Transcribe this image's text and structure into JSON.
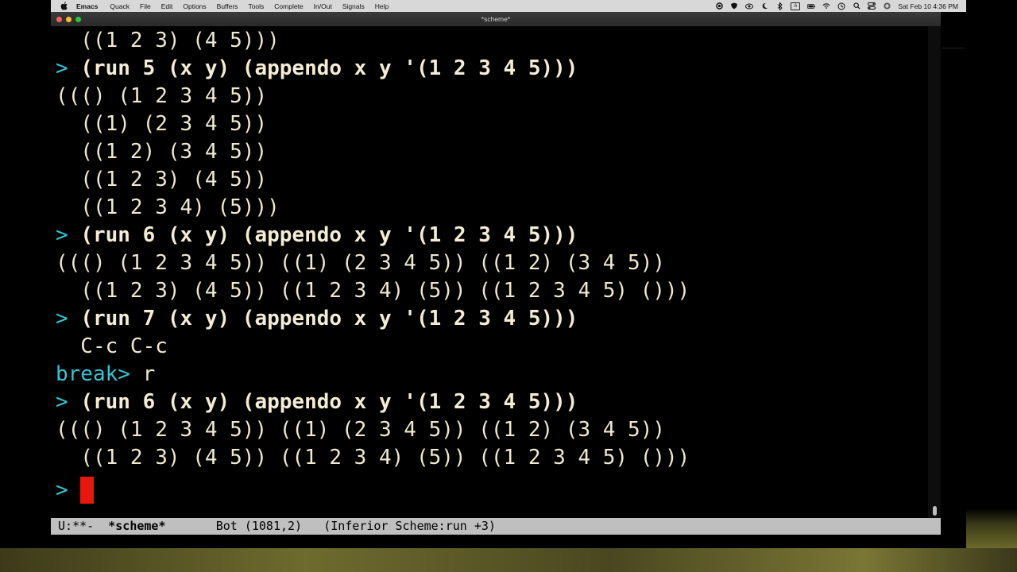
{
  "menubar": {
    "app_name": "Emacs",
    "items": [
      "Quack",
      "File",
      "Edit",
      "Options",
      "Buffers",
      "Tools",
      "Complete",
      "In/Out",
      "Signals",
      "Help"
    ],
    "clock": "Sat Feb 10  4:36 PM"
  },
  "window": {
    "title": "*scheme*"
  },
  "repl_lines": [
    {
      "type": "output",
      "text": "  ((1 2 3) (4 5)))"
    },
    {
      "type": "input",
      "prompt": "> ",
      "text": "(run 5 (x y) (appendo x y '(1 2 3 4 5)))"
    },
    {
      "type": "output",
      "text": "((() (1 2 3 4 5))"
    },
    {
      "type": "output",
      "text": "  ((1) (2 3 4 5))"
    },
    {
      "type": "output",
      "text": "  ((1 2) (3 4 5))"
    },
    {
      "type": "output",
      "text": "  ((1 2 3) (4 5))"
    },
    {
      "type": "output",
      "text": "  ((1 2 3 4) (5)))"
    },
    {
      "type": "input",
      "prompt": "> ",
      "text": "(run 6 (x y) (appendo x y '(1 2 3 4 5)))"
    },
    {
      "type": "output",
      "text": "((() (1 2 3 4 5)) ((1) (2 3 4 5)) ((1 2) (3 4 5))"
    },
    {
      "type": "output",
      "text": "  ((1 2 3) (4 5)) ((1 2 3 4) (5)) ((1 2 3 4 5) ()))"
    },
    {
      "type": "input",
      "prompt": "> ",
      "text": "(run 7 (x y) (appendo x y '(1 2 3 4 5)))"
    },
    {
      "type": "output",
      "text": "  C-c C-c"
    },
    {
      "type": "break",
      "prompt": "break> ",
      "text": "r"
    },
    {
      "type": "input",
      "prompt": "> ",
      "text": "(run 6 (x y) (appendo x y '(1 2 3 4 5)))"
    },
    {
      "type": "output",
      "text": "((() (1 2 3 4 5)) ((1) (2 3 4 5)) ((1 2) (3 4 5))"
    },
    {
      "type": "output",
      "text": "  ((1 2 3) (4 5)) ((1 2 3 4) (5)) ((1 2 3 4 5) ()))"
    }
  ],
  "current_prompt": "> ",
  "modeline": {
    "status": "U:**-  ",
    "buffer_name": "*scheme*",
    "position": "Bot (1081,2)",
    "mode": "(Inferior Scheme:run +3)"
  },
  "colors": {
    "prompt": "#32c6d2",
    "text": "#f0e8cf",
    "cursor": "#e8170e",
    "modeline_bg": "#bfbfbf"
  }
}
